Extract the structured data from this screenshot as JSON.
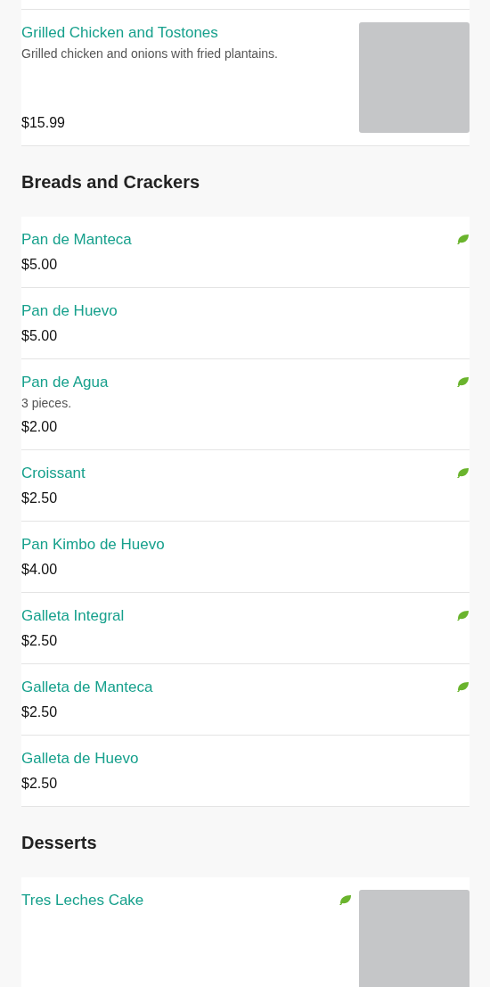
{
  "sections": [
    {
      "items": [
        {
          "name": "Grilled Chicken and Tostones",
          "description": "Grilled chicken and onions with fried plantains.",
          "price": "$15.99",
          "vegetarian": false,
          "photo": true
        }
      ]
    },
    {
      "heading": "Breads and Crackers",
      "items": [
        {
          "name": "Pan de Manteca",
          "price": "$5.00",
          "vegetarian": true,
          "photo": false
        },
        {
          "name": "Pan de Huevo",
          "price": "$5.00",
          "vegetarian": false,
          "photo": false
        },
        {
          "name": "Pan de Agua",
          "description": "3 pieces.",
          "price": "$2.00",
          "vegetarian": true,
          "photo": false
        },
        {
          "name": "Croissant",
          "price": "$2.50",
          "vegetarian": true,
          "photo": false
        },
        {
          "name": "Pan Kimbo de Huevo",
          "price": "$4.00",
          "vegetarian": false,
          "photo": false
        },
        {
          "name": "Galleta Integral",
          "price": "$2.50",
          "vegetarian": true,
          "photo": false
        },
        {
          "name": "Galleta de Manteca",
          "price": "$2.50",
          "vegetarian": true,
          "photo": false
        },
        {
          "name": "Galleta de Huevo",
          "price": "$2.50",
          "vegetarian": false,
          "photo": false
        }
      ]
    },
    {
      "heading": "Desserts",
      "items": [
        {
          "name": "Tres Leches Cake",
          "vegetarian": true,
          "photo": true
        }
      ]
    }
  ]
}
